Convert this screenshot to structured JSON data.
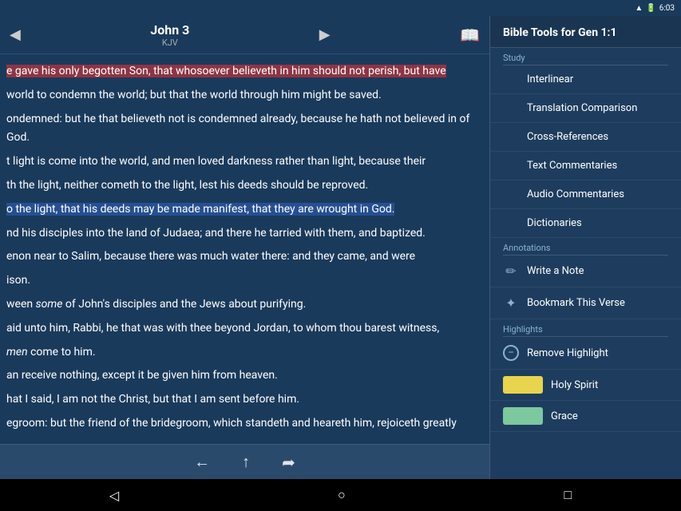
{
  "statusBar": {
    "time": "6:03",
    "icons": [
      "wifi",
      "battery"
    ]
  },
  "bibleHeader": {
    "bookName": "John 3",
    "version": "KJV",
    "prevArrow": "◀",
    "nextArrow": "▶",
    "bookIcon": "📖"
  },
  "bibleText": [
    "e gave his only begotten Son, that whosoever believeth in him should not perish, but have",
    "world to condemn the world; but that the world through him might be saved.",
    "ondemned: but he that believeth not is condemned already, because he hath not believed in of God.",
    "t light is come into the world, and men loved darkness rather than light, because their",
    "th the light, neither cometh to the light, lest his deeds should be reproved.",
    "o the light, that his deeds may be made manifest, that they are wrought in God.",
    "nd his disciples into the land of Judaea; and there he tarried with them, and baptized.",
    "enon near to Salim, because there was much water there: and they came, and were",
    "ison.",
    "ween some of John's disciples and the Jews about purifying.",
    "aid unto him, Rabbi, he that was with thee beyond Jordan, to whom thou barest witness,",
    "men come to him.",
    "an receive nothing, except it be given him from heaven.",
    "hat I said, I am not the Christ, but that I am sent before him.",
    "egroom: but the friend of the bridegroom, which standeth and heareth him, rejoiceth greatly"
  ],
  "bottomNav": {
    "backLabel": "←",
    "upLabel": "↑",
    "shareLabel": "→"
  },
  "toolsPanel": {
    "title": "Bible Tools for Gen 1:1",
    "studyLabel": "Study",
    "items": [
      {
        "id": "interlinear",
        "label": "Interlinear",
        "icon": ""
      },
      {
        "id": "translation-comparison",
        "label": "Translation Comparison",
        "icon": ""
      },
      {
        "id": "cross-references",
        "label": "Cross-References",
        "icon": ""
      },
      {
        "id": "text-commentaries",
        "label": "Text Commentaries",
        "icon": ""
      },
      {
        "id": "audio-commentaries",
        "label": "Audio Commentaries",
        "icon": ""
      },
      {
        "id": "dictionaries",
        "label": "Dictionaries",
        "icon": ""
      }
    ],
    "annotationsLabel": "Annotations",
    "annotations": [
      {
        "id": "write-note",
        "label": "Write a Note",
        "icon": "✏"
      },
      {
        "id": "bookmark",
        "label": "Bookmark This Verse",
        "icon": "★"
      }
    ],
    "highlightsLabel": "Highlights",
    "highlights": [
      {
        "id": "remove-highlight",
        "label": "Remove Highlight",
        "icon": "remove"
      },
      {
        "id": "holy-spirit",
        "label": "Holy Spirit",
        "color": "yellow"
      },
      {
        "id": "grace",
        "label": "Grace",
        "color": "green"
      }
    ]
  }
}
